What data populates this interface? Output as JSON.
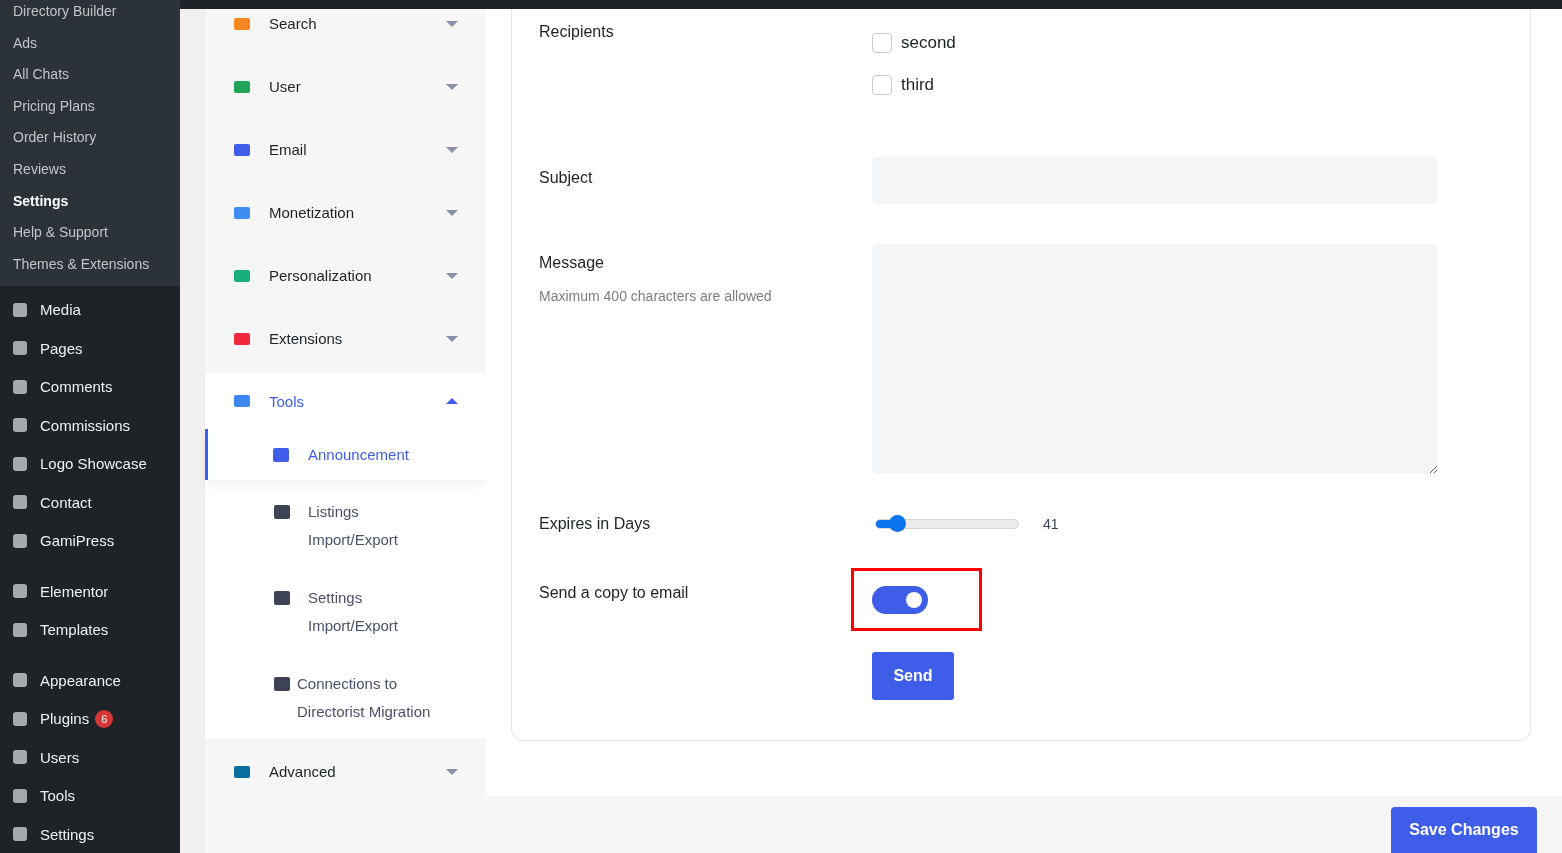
{
  "admin_menu": {
    "submenu": [
      {
        "label": "Directory Builder",
        "selected": false
      },
      {
        "label": "Ads",
        "selected": false
      },
      {
        "label": "All Chats",
        "selected": false
      },
      {
        "label": "Pricing Plans",
        "selected": false
      },
      {
        "label": "Order History",
        "selected": false
      },
      {
        "label": "Reviews",
        "selected": false
      },
      {
        "label": "Settings",
        "selected": true
      },
      {
        "label": "Help & Support",
        "selected": false
      },
      {
        "label": "Themes & Extensions",
        "selected": false
      }
    ],
    "groups": [
      [
        {
          "label": "Media"
        },
        {
          "label": "Pages"
        },
        {
          "label": "Comments"
        },
        {
          "label": "Commissions"
        },
        {
          "label": "Logo Showcase"
        },
        {
          "label": "Contact"
        },
        {
          "label": "GamiPress"
        }
      ],
      [
        {
          "label": "Elementor"
        },
        {
          "label": "Templates"
        }
      ],
      [
        {
          "label": "Appearance"
        },
        {
          "label": "Plugins",
          "badge": "6"
        },
        {
          "label": "Users"
        },
        {
          "label": "Tools"
        },
        {
          "label": "Settings"
        }
      ]
    ]
  },
  "settings_nav": [
    {
      "label": "Search",
      "expanded": false
    },
    {
      "label": "User",
      "expanded": false
    },
    {
      "label": "Email",
      "expanded": false
    },
    {
      "label": "Monetization",
      "expanded": false
    },
    {
      "label": "Personalization",
      "expanded": false
    },
    {
      "label": "Extensions",
      "expanded": false
    },
    {
      "label": "Tools",
      "expanded": true,
      "children": [
        {
          "label": "Announcement",
          "selected": true
        },
        {
          "label": "Listings Import/Export",
          "selected": false
        },
        {
          "label": "Settings Import/Export",
          "selected": false
        },
        {
          "label": "Connections to Directorist Migration",
          "selected": false
        }
      ]
    },
    {
      "label": "Advanced",
      "expanded": false
    }
  ],
  "form": {
    "recipients": {
      "label": "Recipients",
      "options": [
        {
          "label": "second",
          "checked": false
        },
        {
          "label": "third",
          "checked": false
        }
      ]
    },
    "subject": {
      "label": "Subject"
    },
    "message": {
      "label": "Message",
      "hint": "Maximum 400 characters are allowed"
    },
    "expires": {
      "label": "Expires in Days",
      "level": 0.15,
      "reading": "41"
    },
    "send_copy": {
      "label": "Send a copy to email",
      "on": true,
      "highlighted": true
    },
    "send_button": "Send"
  },
  "save_button": "Save Changes"
}
